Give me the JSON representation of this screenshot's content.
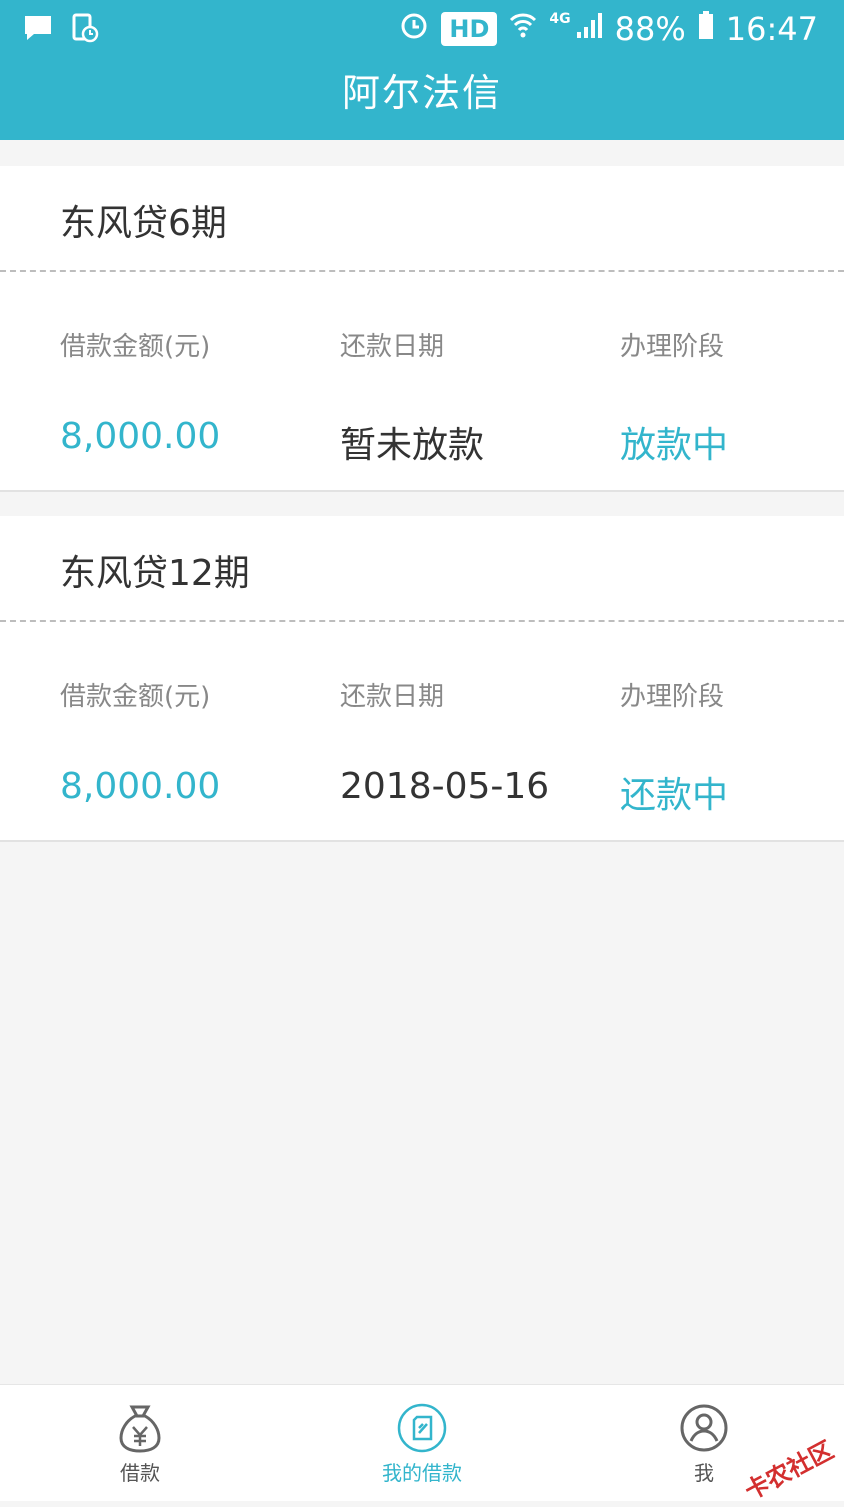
{
  "status_bar": {
    "hd": "HD",
    "network": "4G",
    "battery": "88%",
    "time": "16:47"
  },
  "header": {
    "title": "阿尔法信"
  },
  "loans": [
    {
      "title": "东风贷6期",
      "labels": {
        "amount": "借款金额(元)",
        "date": "还款日期",
        "stage": "办理阶段"
      },
      "amount": "8,000.00",
      "date": "暂未放款",
      "stage": "放款中"
    },
    {
      "title": "东风贷12期",
      "labels": {
        "amount": "借款金额(元)",
        "date": "还款日期",
        "stage": "办理阶段"
      },
      "amount": "8,000.00",
      "date": "2018-05-16",
      "stage": "还款中"
    }
  ],
  "tabbar": {
    "tabs": [
      {
        "label": "借款",
        "icon": "money-bag-icon"
      },
      {
        "label": "我的借款",
        "icon": "document-icon",
        "active": true
      },
      {
        "label": "我",
        "icon": "user-icon"
      }
    ]
  },
  "watermark": "卡农社区",
  "colors": {
    "accent": "#33b5cc",
    "text": "#333333",
    "muted": "#888888"
  }
}
